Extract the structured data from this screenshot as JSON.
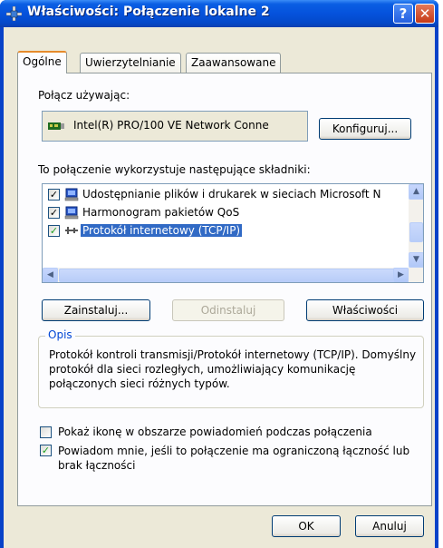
{
  "window": {
    "title": "Właściwości: Połączenie lokalne 2",
    "help_label": "?",
    "close_label": "✕"
  },
  "tabs": [
    {
      "label": "Ogólne",
      "active": true
    },
    {
      "label": "Uwierzytelnianie",
      "active": false
    },
    {
      "label": "Zaawansowane",
      "active": false
    }
  ],
  "connect_using": {
    "label": "Połącz używając:",
    "adapter": "Intel(R) PRO/100 VE Network Conne",
    "configure_button": "Konfiguruj..."
  },
  "components": {
    "label": "To połączenie wykorzystuje następujące składniki:",
    "items": [
      {
        "label": "Udostępnianie plików i drukarek w sieciach Microsoft N",
        "checked": true,
        "icon": "network-service-icon"
      },
      {
        "label": "Harmonogram pakietów QoS",
        "checked": true,
        "icon": "network-service-icon"
      },
      {
        "label": "Protokół internetowy (TCP/IP)",
        "checked": true,
        "selected": true,
        "icon": "protocol-icon"
      }
    ]
  },
  "buttons": {
    "install": "Zainstaluj...",
    "uninstall": "Odinstaluj",
    "properties": "Właściwości"
  },
  "description": {
    "title": "Opis",
    "text": "Protokół kontroli transmisji/Protokół internetowy (TCP/IP). Domyślny protokół dla sieci rozległych, umożliwiający komunikację połączonych sieci różnych typów."
  },
  "options": {
    "show_icon": {
      "label": "Pokaż ikonę w obszarze powiadomień podczas połączenia",
      "checked": false
    },
    "notify": {
      "label": "Powiadom mnie, jeśli to połączenie ma ograniczoną łączność lub brak łączności",
      "checked": true
    }
  },
  "footer": {
    "ok": "OK",
    "cancel": "Anuluj"
  },
  "colors": {
    "title_bar": "#0552dc",
    "selection": "#316ac5",
    "group_title": "#0046d5"
  }
}
